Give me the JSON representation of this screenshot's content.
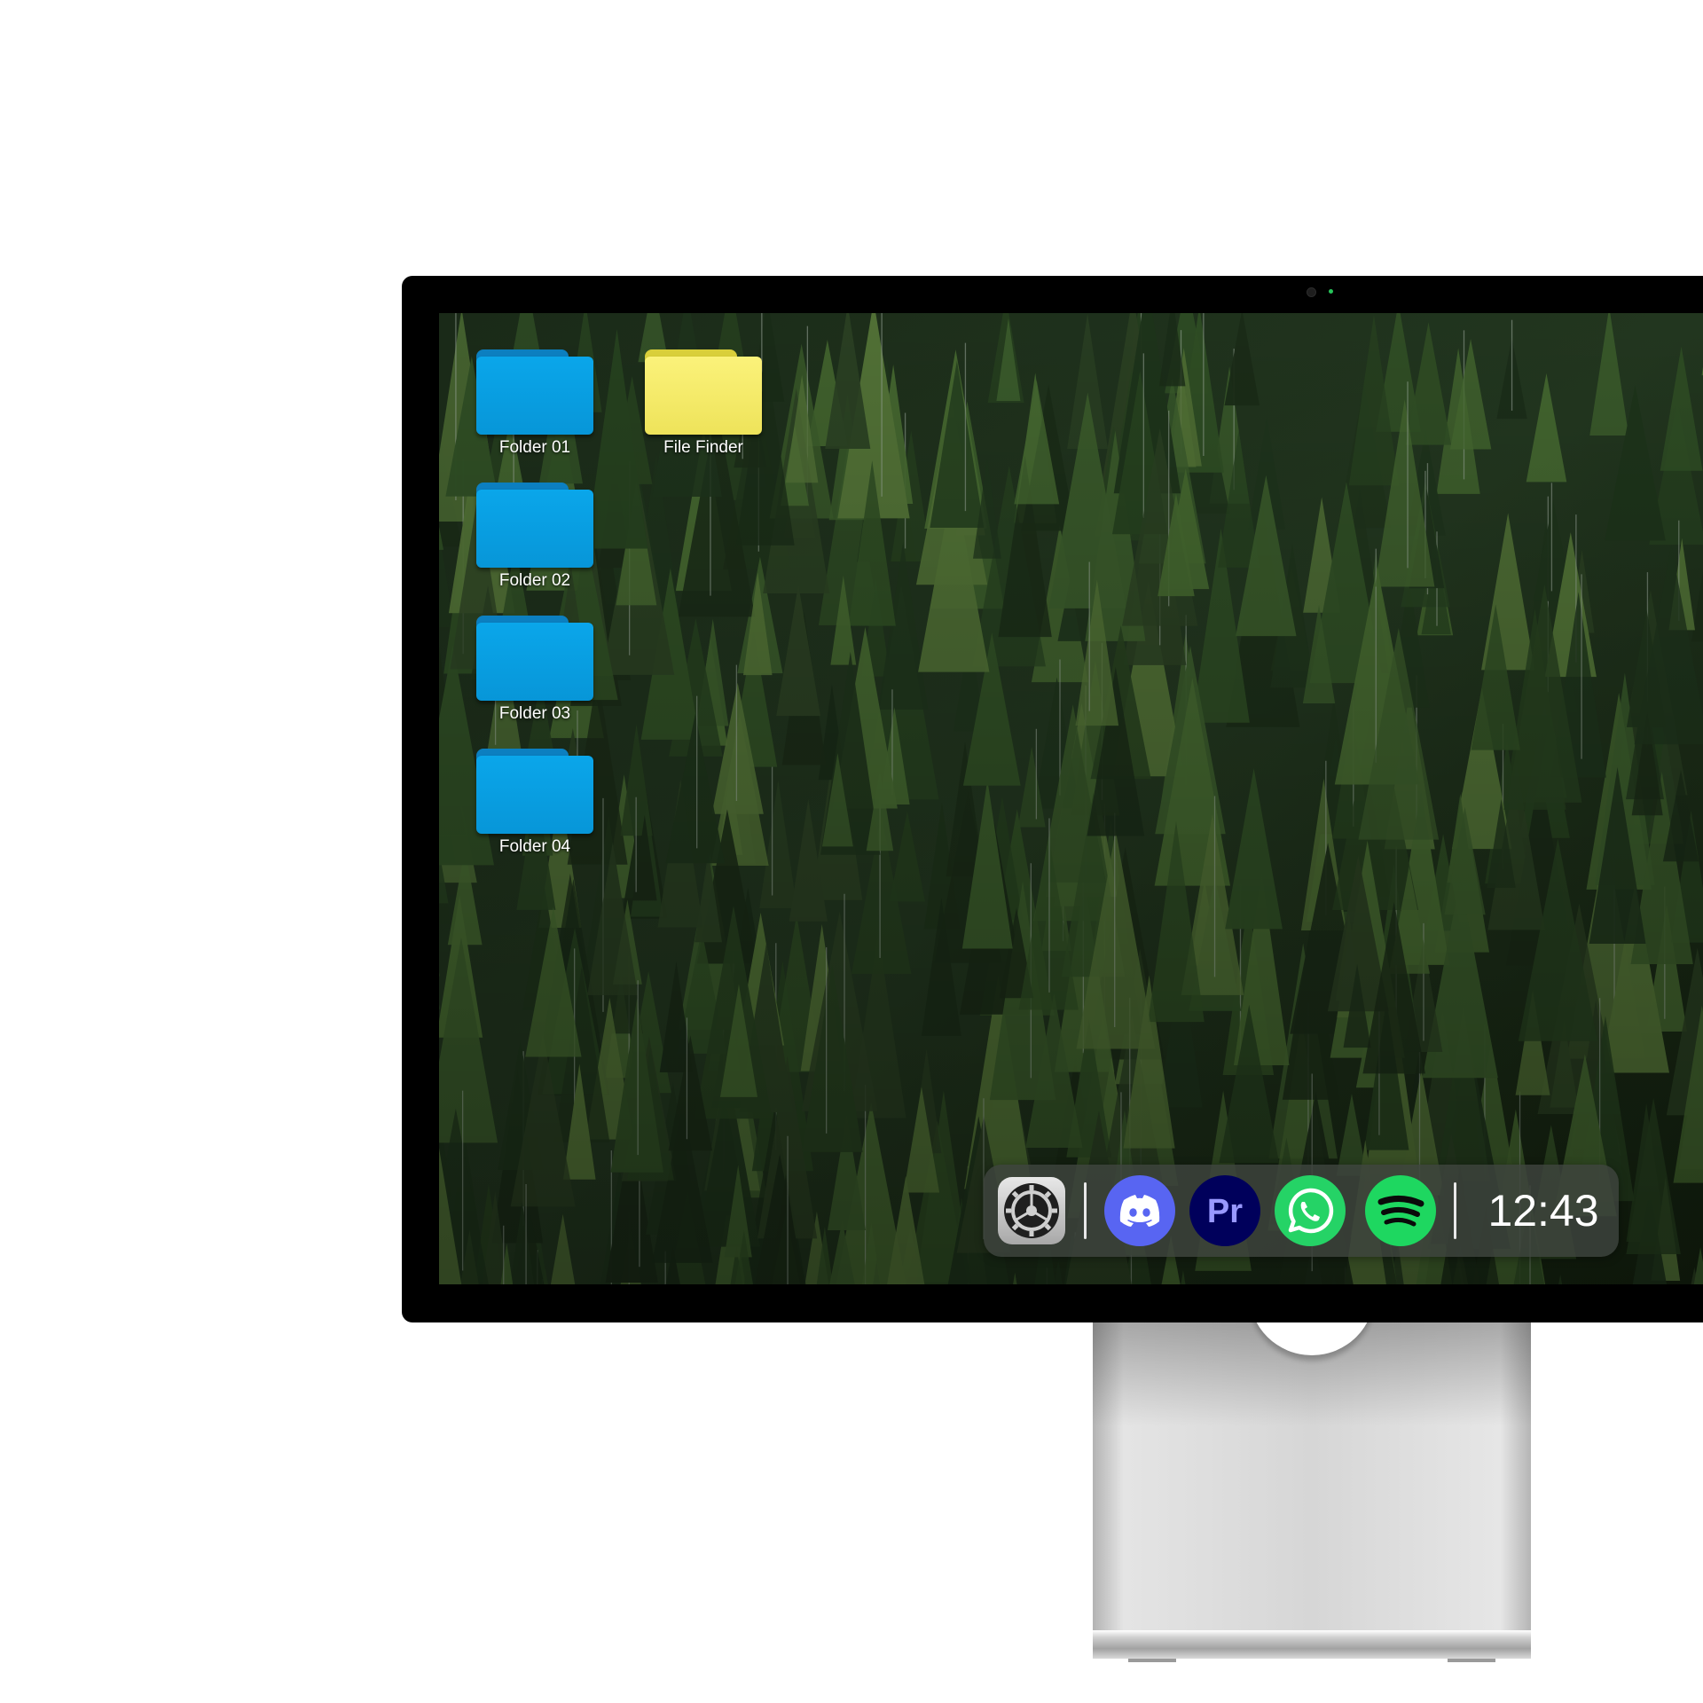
{
  "desktop": {
    "icons": [
      {
        "label": "Folder 01",
        "icon": "blue-folder-icon",
        "color": "#0aa6ea"
      },
      {
        "label": "Folder 02",
        "icon": "blue-folder-icon",
        "color": "#0aa6ea"
      },
      {
        "label": "Folder 03",
        "icon": "blue-folder-icon",
        "color": "#0aa6ea"
      },
      {
        "label": "Folder 04",
        "icon": "blue-folder-icon",
        "color": "#0aa6ea"
      },
      {
        "label": "File Finder",
        "icon": "yellow-folder-icon",
        "color": "#fbf27a"
      }
    ],
    "wallpaper": "forest"
  },
  "dock": {
    "apps": [
      {
        "name": "settings",
        "icon": "gear-icon"
      },
      {
        "name": "discord",
        "icon": "discord-icon",
        "color": "#5865f2"
      },
      {
        "name": "premiere-pro",
        "icon": "premiere-pro-icon",
        "text": "Pr",
        "color": "#00005b",
        "text_color": "#9999ff"
      },
      {
        "name": "whatsapp",
        "icon": "whatsapp-icon",
        "color": "#25d366"
      },
      {
        "name": "spotify",
        "icon": "spotify-icon",
        "color": "#1ed760"
      }
    ],
    "time": "12:43"
  }
}
